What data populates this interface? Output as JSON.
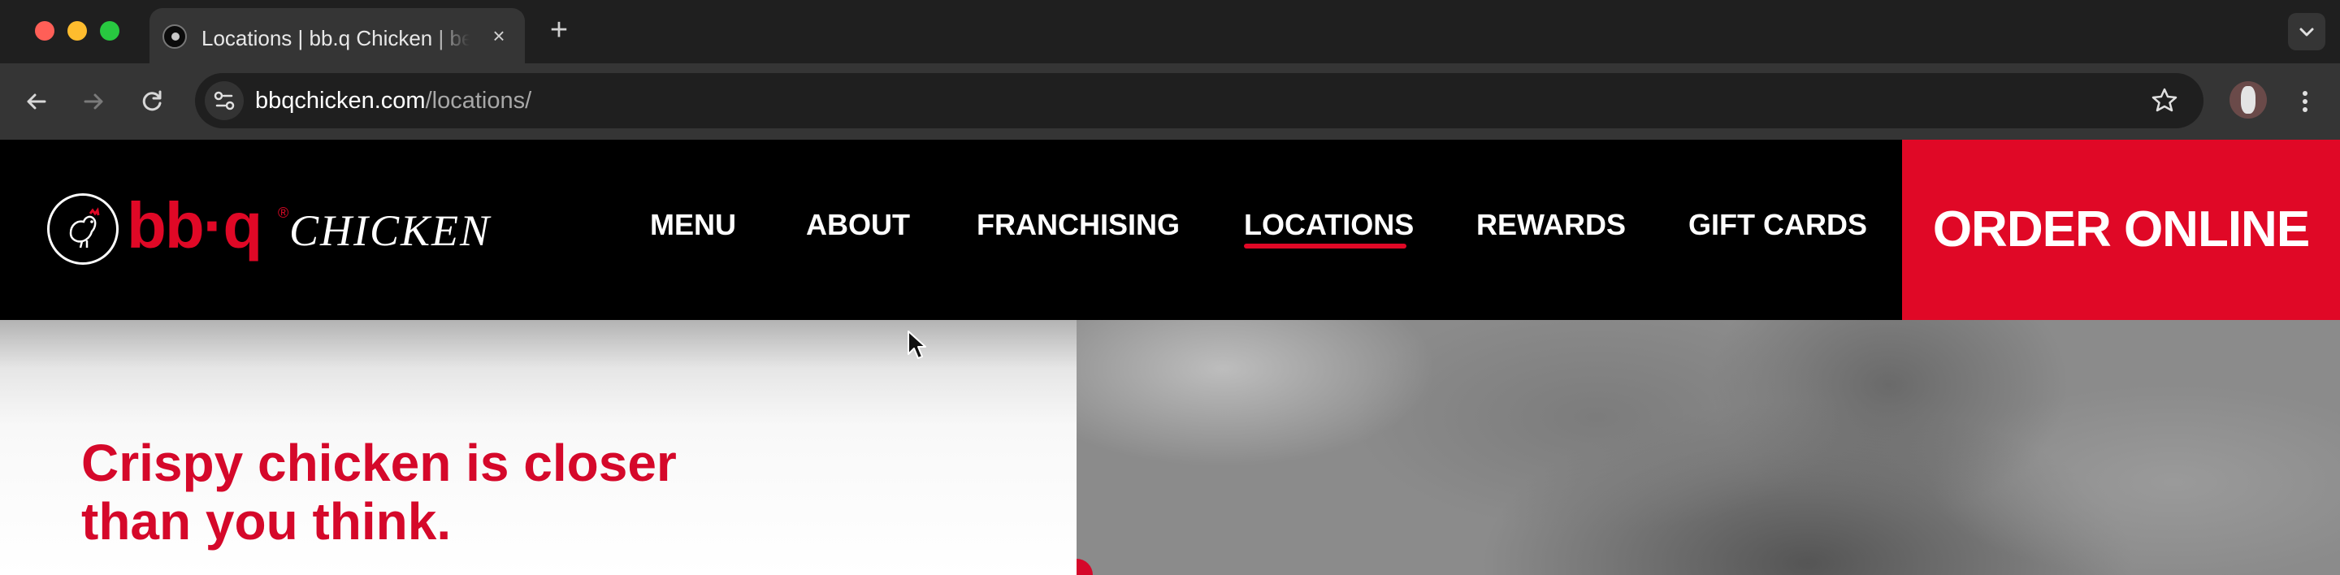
{
  "browser": {
    "tab_title": "Locations | bb.q Chicken | best Korean fried chicken",
    "tab_close": "×",
    "new_tab": "+",
    "url_domain": "bbqchicken.com",
    "url_path": "/locations/"
  },
  "header": {
    "logo_bbq": "bb·q",
    "logo_reg": "®",
    "logo_chicken": "CHICKEN",
    "nav": {
      "menu": "MENU",
      "about": "ABOUT",
      "franchising": "FRANCHISING",
      "locations": "LOCATIONS",
      "rewards": "REWARDS",
      "gift_cards": "GIFT CARDS"
    },
    "active_nav": "LOCATIONS",
    "order_button": "ORDER ONLINE"
  },
  "hero": {
    "heading_line1": "Crispy chicken is closer",
    "heading_line2": "than you think."
  },
  "colors": {
    "brand_red": "#e00826",
    "header_bg": "#000000",
    "chrome_dark": "#1f1f1f",
    "chrome_toolbar": "#353535"
  },
  "icons": [
    "back-icon",
    "forward-icon",
    "reload-icon",
    "site-info-icon",
    "bookmark-star-icon",
    "profile-avatar",
    "more-menu-icon",
    "tab-list-icon",
    "close-icon",
    "logo-chicken-emblem-icon"
  ]
}
